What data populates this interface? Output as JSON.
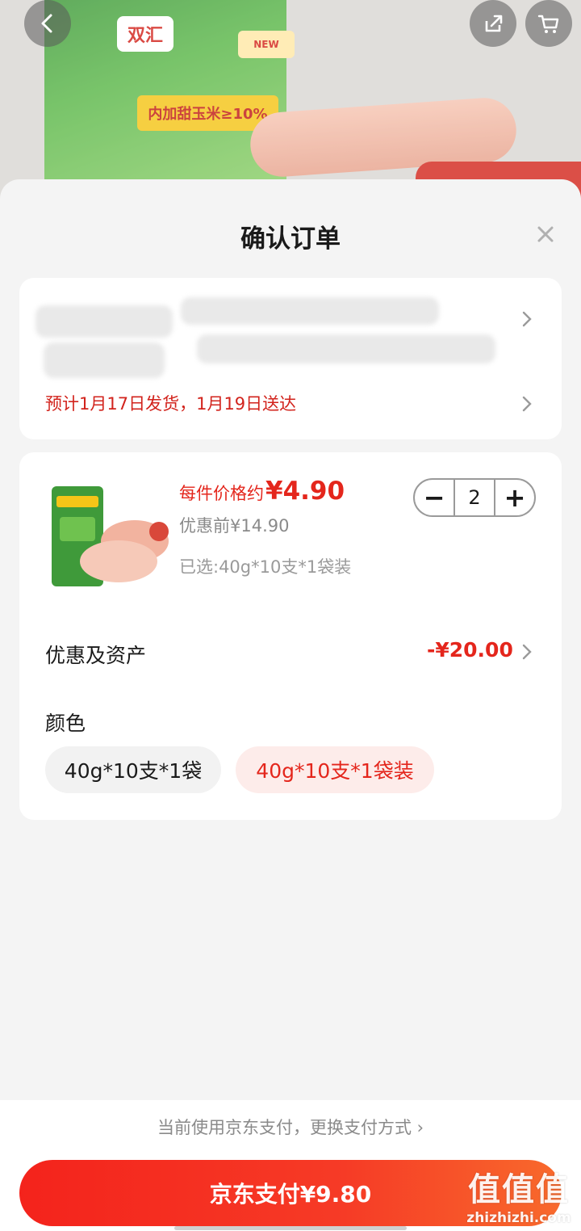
{
  "hero": {
    "brand_logo_text": "双汇",
    "band_text": "内加甜玉米≥10%",
    "new_badge_text": "NEW"
  },
  "sheet": {
    "title": "确认订单"
  },
  "address": {
    "delivery_text": "预计1月17日发货，1月19日送达"
  },
  "product": {
    "price_prefix": "每件价格约",
    "price": "¥4.90",
    "original_price": "优惠前¥14.90",
    "selected_spec": "已选:40g*10支*1袋装",
    "quantity": "2",
    "minus_label": "−",
    "plus_label": "+"
  },
  "discount": {
    "label": "优惠及资产",
    "value": "-¥20.00"
  },
  "color": {
    "label": "颜色",
    "options": [
      "40g*10支*1袋",
      "40g*10支*1袋装"
    ]
  },
  "footer": {
    "pay_switch": "当前使用京东支付，更换支付方式 ›",
    "pay_button": "京东支付¥9.80"
  },
  "watermark": {
    "big": "值值值",
    "small": "zhizhizhi.com"
  },
  "colors": {
    "accent": "#e4261c",
    "pay_gradient_start": "#f4231c",
    "pay_gradient_end": "#f86a2c",
    "selected_option_bg": "#fdecea"
  }
}
